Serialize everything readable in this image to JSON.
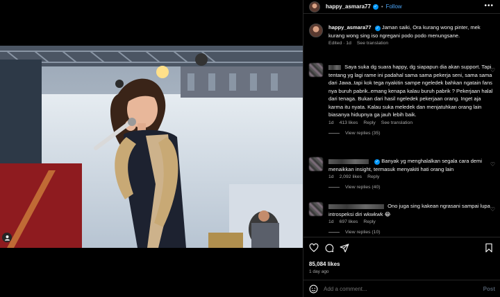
{
  "post": {
    "username": "happy_asmara77",
    "follow_label": "Follow",
    "separator": "•",
    "caption_text": "Jaman saiki, Ora kurang wong pinter, mek kurang wong sing iso ngregani podo podo menungsane.",
    "caption_meta": {
      "edited": "Edited · 1d",
      "see_translation": "See translation"
    }
  },
  "comments": [
    {
      "text": "Saya suka dg suara happy, dg siapapun dia akan support. Tapi tentang yg lagi rame ini padahal sama sama pekerja seni, sama sama dari Jawa..tapi kok tega nyakitin sampe ngeledek bahkan ngatain fans nya buruh pabrik..emang kenapa kalau buruh pabrik ? Pekerjaan halal dari tenaga. Bukan dari hasil ngeledek pekerjaan orang. Inget aja karma itu nyata. Kalau suka meledek dan menjatuhkan orang lain biasanya hidupnya ga jauh lebih baik.",
      "time": "1d",
      "likes": "413 likes",
      "reply": "Reply",
      "translation": "See translation",
      "view_replies": "View replies (35)"
    },
    {
      "text": "Banyak yg menghalalkan segala cara demi menaikkan insight, termasuk menyakiti hati orang lain",
      "time": "1d",
      "likes": "2,092 likes",
      "reply": "Reply",
      "view_replies": "View replies (40)"
    },
    {
      "text": "Ono juga sing kakean ngrasani sampai lupa introspeksi diri wkwkwk 😂",
      "time": "1d",
      "likes": "697 likes",
      "reply": "Reply",
      "view_replies": "View replies (10)"
    }
  ],
  "engagement": {
    "likes": "85,084 likes",
    "time": "1 day ago"
  },
  "composer": {
    "placeholder": "Add a comment...",
    "post_label": "Post"
  },
  "icons": {
    "more": "more-options-icon",
    "like": "heart-icon",
    "comment": "comment-icon",
    "share": "share-icon",
    "save": "bookmark-icon",
    "emoji": "emoji-icon",
    "tag": "user-tag-icon"
  },
  "colors": {
    "background": "#000000",
    "link": "#4ca5f7",
    "verified": "#0095f6",
    "muted": "#a8a8a8"
  }
}
